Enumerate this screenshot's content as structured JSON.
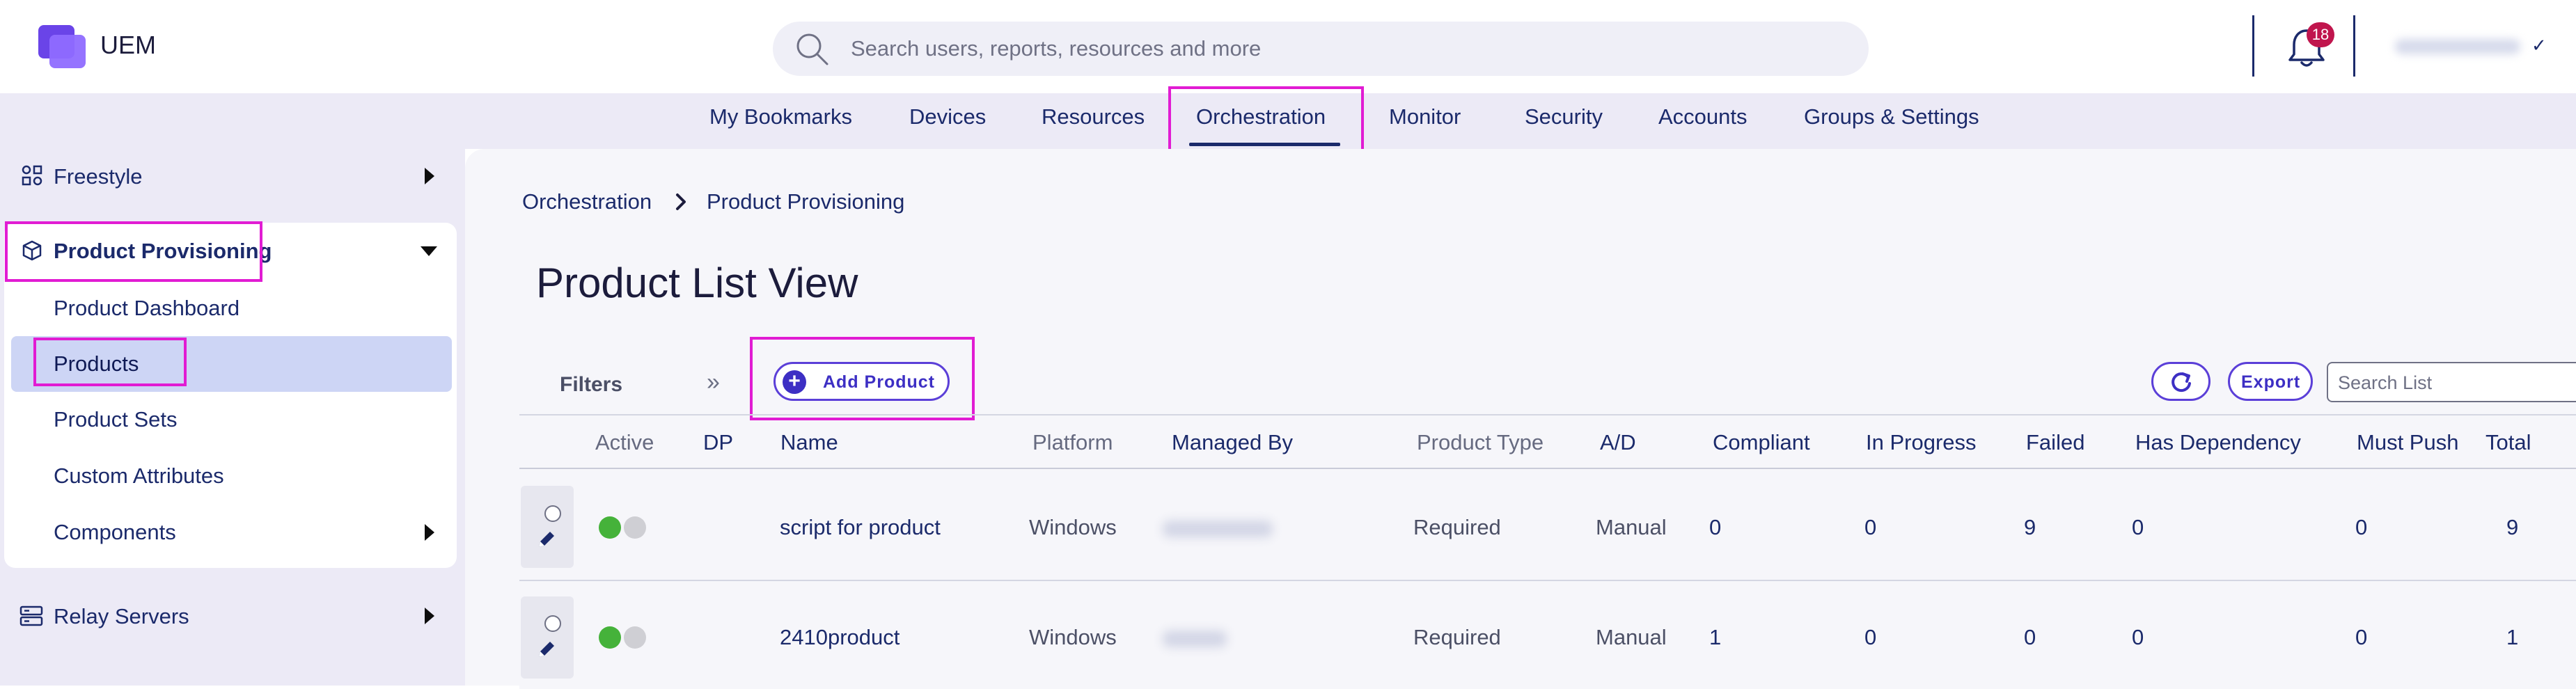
{
  "app": {
    "name": "UEM"
  },
  "header": {
    "search_placeholder": "Search users, reports, resources and more",
    "notification_count": "18"
  },
  "nav": {
    "items": [
      "My Bookmarks",
      "Devices",
      "Resources",
      "Orchestration",
      "Monitor",
      "Security",
      "Accounts",
      "Groups & Settings"
    ],
    "active": "Orchestration"
  },
  "sidebar": {
    "freestyle": "Freestyle",
    "product_provisioning": "Product Provisioning",
    "sub_items": [
      "Product Dashboard",
      "Products",
      "Product Sets",
      "Custom Attributes",
      "Components"
    ],
    "active_sub": "Products",
    "relay_servers": "Relay Servers"
  },
  "breadcrumb": [
    "Orchestration",
    "Product Provisioning"
  ],
  "page_title": "Product List View",
  "toolbar": {
    "filters": "Filters",
    "add_product": "Add Product",
    "export": "Export",
    "search_placeholder": "Search List"
  },
  "table": {
    "columns": [
      "Active",
      "DP",
      "Name",
      "Platform",
      "Managed By",
      "Product Type",
      "A/D",
      "Compliant",
      "In Progress",
      "Failed",
      "Has Dependency",
      "Must Push",
      "Total"
    ],
    "rows": [
      {
        "name": "script for product",
        "platform": "Windows",
        "product_type": "Required",
        "ad": "Manual",
        "compliant": "0",
        "in_progress": "0",
        "failed": "9",
        "has_dependency": "0",
        "must_push": "0",
        "total": "9"
      },
      {
        "name": "2410product",
        "platform": "Windows",
        "product_type": "Required",
        "ad": "Manual",
        "compliant": "1",
        "in_progress": "0",
        "failed": "0",
        "has_dependency": "0",
        "must_push": "0",
        "total": "1"
      }
    ]
  },
  "colors": {
    "accent": "#5b3fd8",
    "highlight": "#e11cd3",
    "active_green": "#45b23a",
    "badge": "#c0154d"
  }
}
